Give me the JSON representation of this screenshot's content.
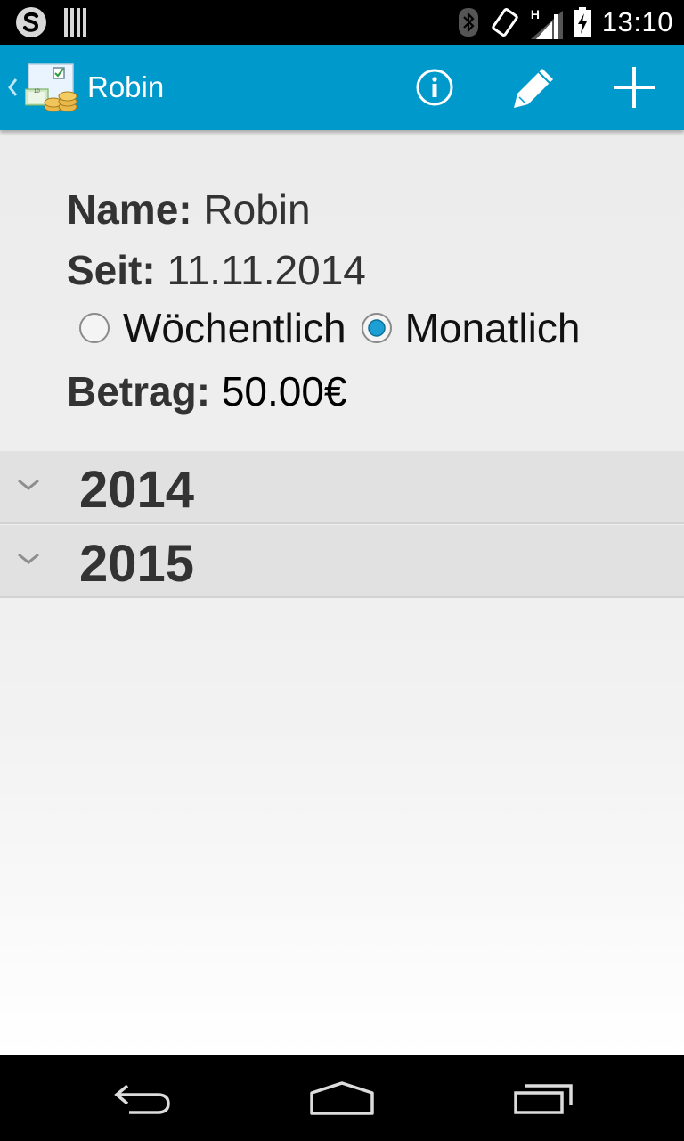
{
  "status_bar": {
    "time": "13:10",
    "network_type": "H",
    "icons": [
      "skype-icon",
      "barcode-icon",
      "bluetooth-icon",
      "vibrate-icon",
      "signal-icon",
      "battery-icon"
    ]
  },
  "action_bar": {
    "title": "Robin",
    "background_color": "#0099cc",
    "actions": [
      {
        "icon": "info-icon",
        "label": "Info"
      },
      {
        "icon": "edit-icon",
        "label": "Edit"
      },
      {
        "icon": "add-icon",
        "label": "Add"
      }
    ]
  },
  "details": {
    "name_label": "Name:",
    "name_value": "Robin",
    "since_label": "Seit:",
    "since_value": "11.11.2014",
    "frequency_options": [
      {
        "label": "Wöchentlich",
        "selected": false
      },
      {
        "label": "Monatlich",
        "selected": true
      }
    ],
    "amount_label": "Betrag:",
    "amount_value": "50.00€"
  },
  "groups": [
    {
      "year": "2014",
      "expanded": false
    },
    {
      "year": "2015",
      "expanded": false
    }
  ],
  "navigation": [
    "back-icon",
    "home-icon",
    "recents-icon"
  ]
}
